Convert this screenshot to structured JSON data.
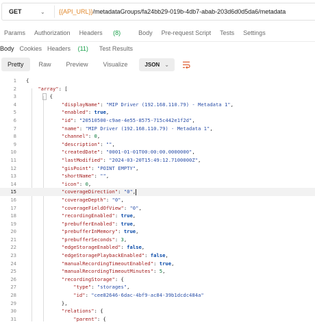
{
  "request": {
    "method": "GET",
    "url_variable": "{{API_URL}}",
    "url_path": "/metadataGroups/fa24bb29-019b-4db7-abab-203d6d0d5da6/metadata"
  },
  "request_tabs": {
    "params": "Params",
    "authorization": "Authorization",
    "headers": "Headers",
    "headers_count": "(8)",
    "body": "Body",
    "pre_request_script": "Pre-request Script",
    "tests": "Tests",
    "settings": "Settings"
  },
  "response_tabs": {
    "body": "Body",
    "cookies": "Cookies",
    "headers": "Headers",
    "headers_count": "(11)",
    "test_results": "Test Results"
  },
  "toolbar": {
    "pretty": "Pretty",
    "raw": "Raw",
    "preview": "Preview",
    "visualize": "Visualize",
    "format": "JSON"
  },
  "code_lines": [
    {
      "n": "1",
      "html": "{"
    },
    {
      "n": "2",
      "html": "    <span class=\"k\">\"array\"</span>: ["
    },
    {
      "n": "3",
      "html": "        {"
    },
    {
      "n": "4",
      "html": "            <span class=\"k\">\"displayName\"</span>: <span class=\"s\">\"MIP Driver (192.168.110.79) - Metadata 1\"</span>,"
    },
    {
      "n": "5",
      "html": "            <span class=\"k\">\"enabled\"</span>: <span class=\"b\">true</span>,"
    },
    {
      "n": "6",
      "html": "            <span class=\"k\">\"id\"</span>: <span class=\"s\">\"20510500-c9ae-4e55-8575-715c442e1f2d\"</span>,"
    },
    {
      "n": "7",
      "html": "            <span class=\"k\">\"name\"</span>: <span class=\"s\">\"MIP Driver (192.168.110.79) - Metadata 1\"</span>,"
    },
    {
      "n": "8",
      "html": "            <span class=\"k\">\"channel\"</span>: <span class=\"n\">0</span>,"
    },
    {
      "n": "9",
      "html": "            <span class=\"k\">\"description\"</span>: <span class=\"s\">\"\"</span>,"
    },
    {
      "n": "10",
      "html": "            <span class=\"k\">\"createdDate\"</span>: <span class=\"s\">\"0001-01-01T00:00:00.0000000\"</span>,"
    },
    {
      "n": "11",
      "html": "            <span class=\"k\">\"lastModified\"</span>: <span class=\"s\">\"2024-03-20T15:49:12.7100000Z\"</span>,"
    },
    {
      "n": "12",
      "html": "            <span class=\"k\">\"gisPoint\"</span>: <span class=\"s\">\"POINT EMPTY\"</span>,"
    },
    {
      "n": "13",
      "html": "            <span class=\"k\">\"shortName\"</span>: <span class=\"s\">\"\"</span>,"
    },
    {
      "n": "14",
      "html": "            <span class=\"k\">\"icon\"</span>: <span class=\"n\">0</span>,"
    },
    {
      "n": "15",
      "html": "            <span class=\"k\">\"coverageDirection\"</span>: <span class=\"s\">\"0\"</span>,<span class=\"cursor\"></span>",
      "highlight": true
    },
    {
      "n": "16",
      "html": "            <span class=\"k\">\"coverageDepth\"</span>: <span class=\"s\">\"0\"</span>,"
    },
    {
      "n": "17",
      "html": "            <span class=\"k\">\"coverageFieldOfView\"</span>: <span class=\"s\">\"0\"</span>,"
    },
    {
      "n": "18",
      "html": "            <span class=\"k\">\"recordingEnabled\"</span>: <span class=\"b\">true</span>,"
    },
    {
      "n": "19",
      "html": "            <span class=\"k\">\"prebufferEnabled\"</span>: <span class=\"b\">true</span>,"
    },
    {
      "n": "20",
      "html": "            <span class=\"k\">\"prebufferInMemory\"</span>: <span class=\"b\">true</span>,"
    },
    {
      "n": "21",
      "html": "            <span class=\"k\">\"prebufferSeconds\"</span>: <span class=\"n\">3</span>,"
    },
    {
      "n": "22",
      "html": "            <span class=\"k\">\"edgeStorageEnabled\"</span>: <span class=\"b\">false</span>,"
    },
    {
      "n": "23",
      "html": "            <span class=\"k\">\"edgeStoragePlaybackEnabled\"</span>: <span class=\"b\">false</span>,"
    },
    {
      "n": "24",
      "html": "            <span class=\"k\">\"manualRecordingTimeoutEnabled\"</span>: <span class=\"b\">true</span>,"
    },
    {
      "n": "25",
      "html": "            <span class=\"k\">\"manualRecordingTimeoutMinutes\"</span>: <span class=\"n\">5</span>,"
    },
    {
      "n": "26",
      "html": "            <span class=\"k\">\"recordingStorage\"</span>: {"
    },
    {
      "n": "27",
      "html": "                <span class=\"k\">\"type\"</span>: <span class=\"s\">\"storages\"</span>,"
    },
    {
      "n": "28",
      "html": "                <span class=\"k\">\"id\"</span>: <span class=\"s\">\"cee82646-6dac-4bf9-ac84-39b1dcdc484a\"</span>"
    },
    {
      "n": "29",
      "html": "            },"
    },
    {
      "n": "30",
      "html": "            <span class=\"k\">\"relations\"</span>: {"
    },
    {
      "n": "31",
      "html": "                <span class=\"k\">\"parent\"</span>: {"
    }
  ]
}
